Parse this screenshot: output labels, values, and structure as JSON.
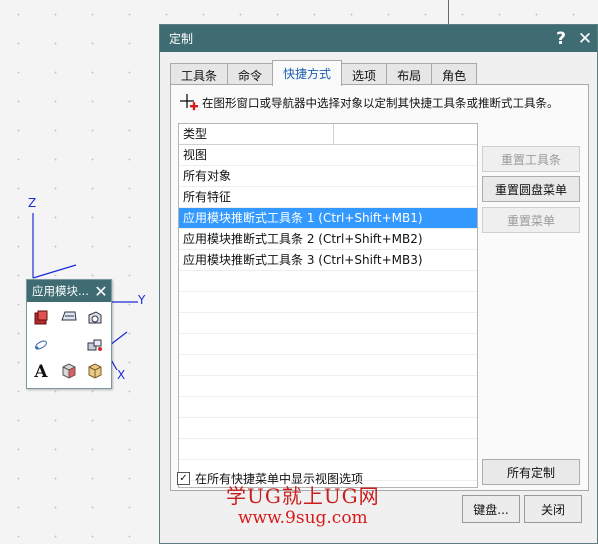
{
  "canvas": {
    "axis_x": "X",
    "axis_y": "Y",
    "axis_z": "Z"
  },
  "mini_toolbar": {
    "title": "应用模块...",
    "close_glyph": "✕",
    "icons": [
      "modeling-icon",
      "shape-studio-icon",
      "sheet-metal-icon",
      "drafting-link-icon",
      "assembly-icon",
      "text-icon",
      "cube-icon",
      "box-icon"
    ]
  },
  "dialog": {
    "title": "定制",
    "help_glyph": "?",
    "close_glyph": "✕",
    "tabs": [
      {
        "label": "工具条"
      },
      {
        "label": "命令"
      },
      {
        "label": "快捷方式",
        "active": true
      },
      {
        "label": "选项"
      },
      {
        "label": "布局"
      },
      {
        "label": "角色"
      }
    ],
    "hint": "在图形窗口或导航器中选择对象以定制其快捷工具条或推断式工具条。",
    "list": {
      "header": "类型",
      "rows": [
        "视图",
        "所有对象",
        "所有特征",
        "应用模块推断式工具条 1 (Ctrl+Shift+MB1)",
        "应用模块推断式工具条 2 (Ctrl+Shift+MB2)",
        "应用模块推断式工具条 3 (Ctrl+Shift+MB3)"
      ],
      "selected_row": "应用模块推断式工具条 1 (Ctrl+Shift+MB1)"
    },
    "buttons": {
      "reset_toolbar": "重置工具条",
      "reset_pie_menu": "重置圆盘菜单",
      "reset_menu": "重置菜单",
      "all_customize": "所有定制"
    },
    "checkbox": {
      "label": "在所有快捷菜单中显示视图选项",
      "checked": true,
      "mark": "✓"
    },
    "footer": {
      "keyboard": "键盘...",
      "close": "关闭"
    }
  },
  "watermark": {
    "line1": "学UG就上UG网",
    "line2": "www.9sug.com"
  },
  "colors": {
    "titlebar": "#3f6b73",
    "selection": "#3399ff",
    "axis": "#1a2bd8",
    "watermark": "#c81e1e"
  }
}
